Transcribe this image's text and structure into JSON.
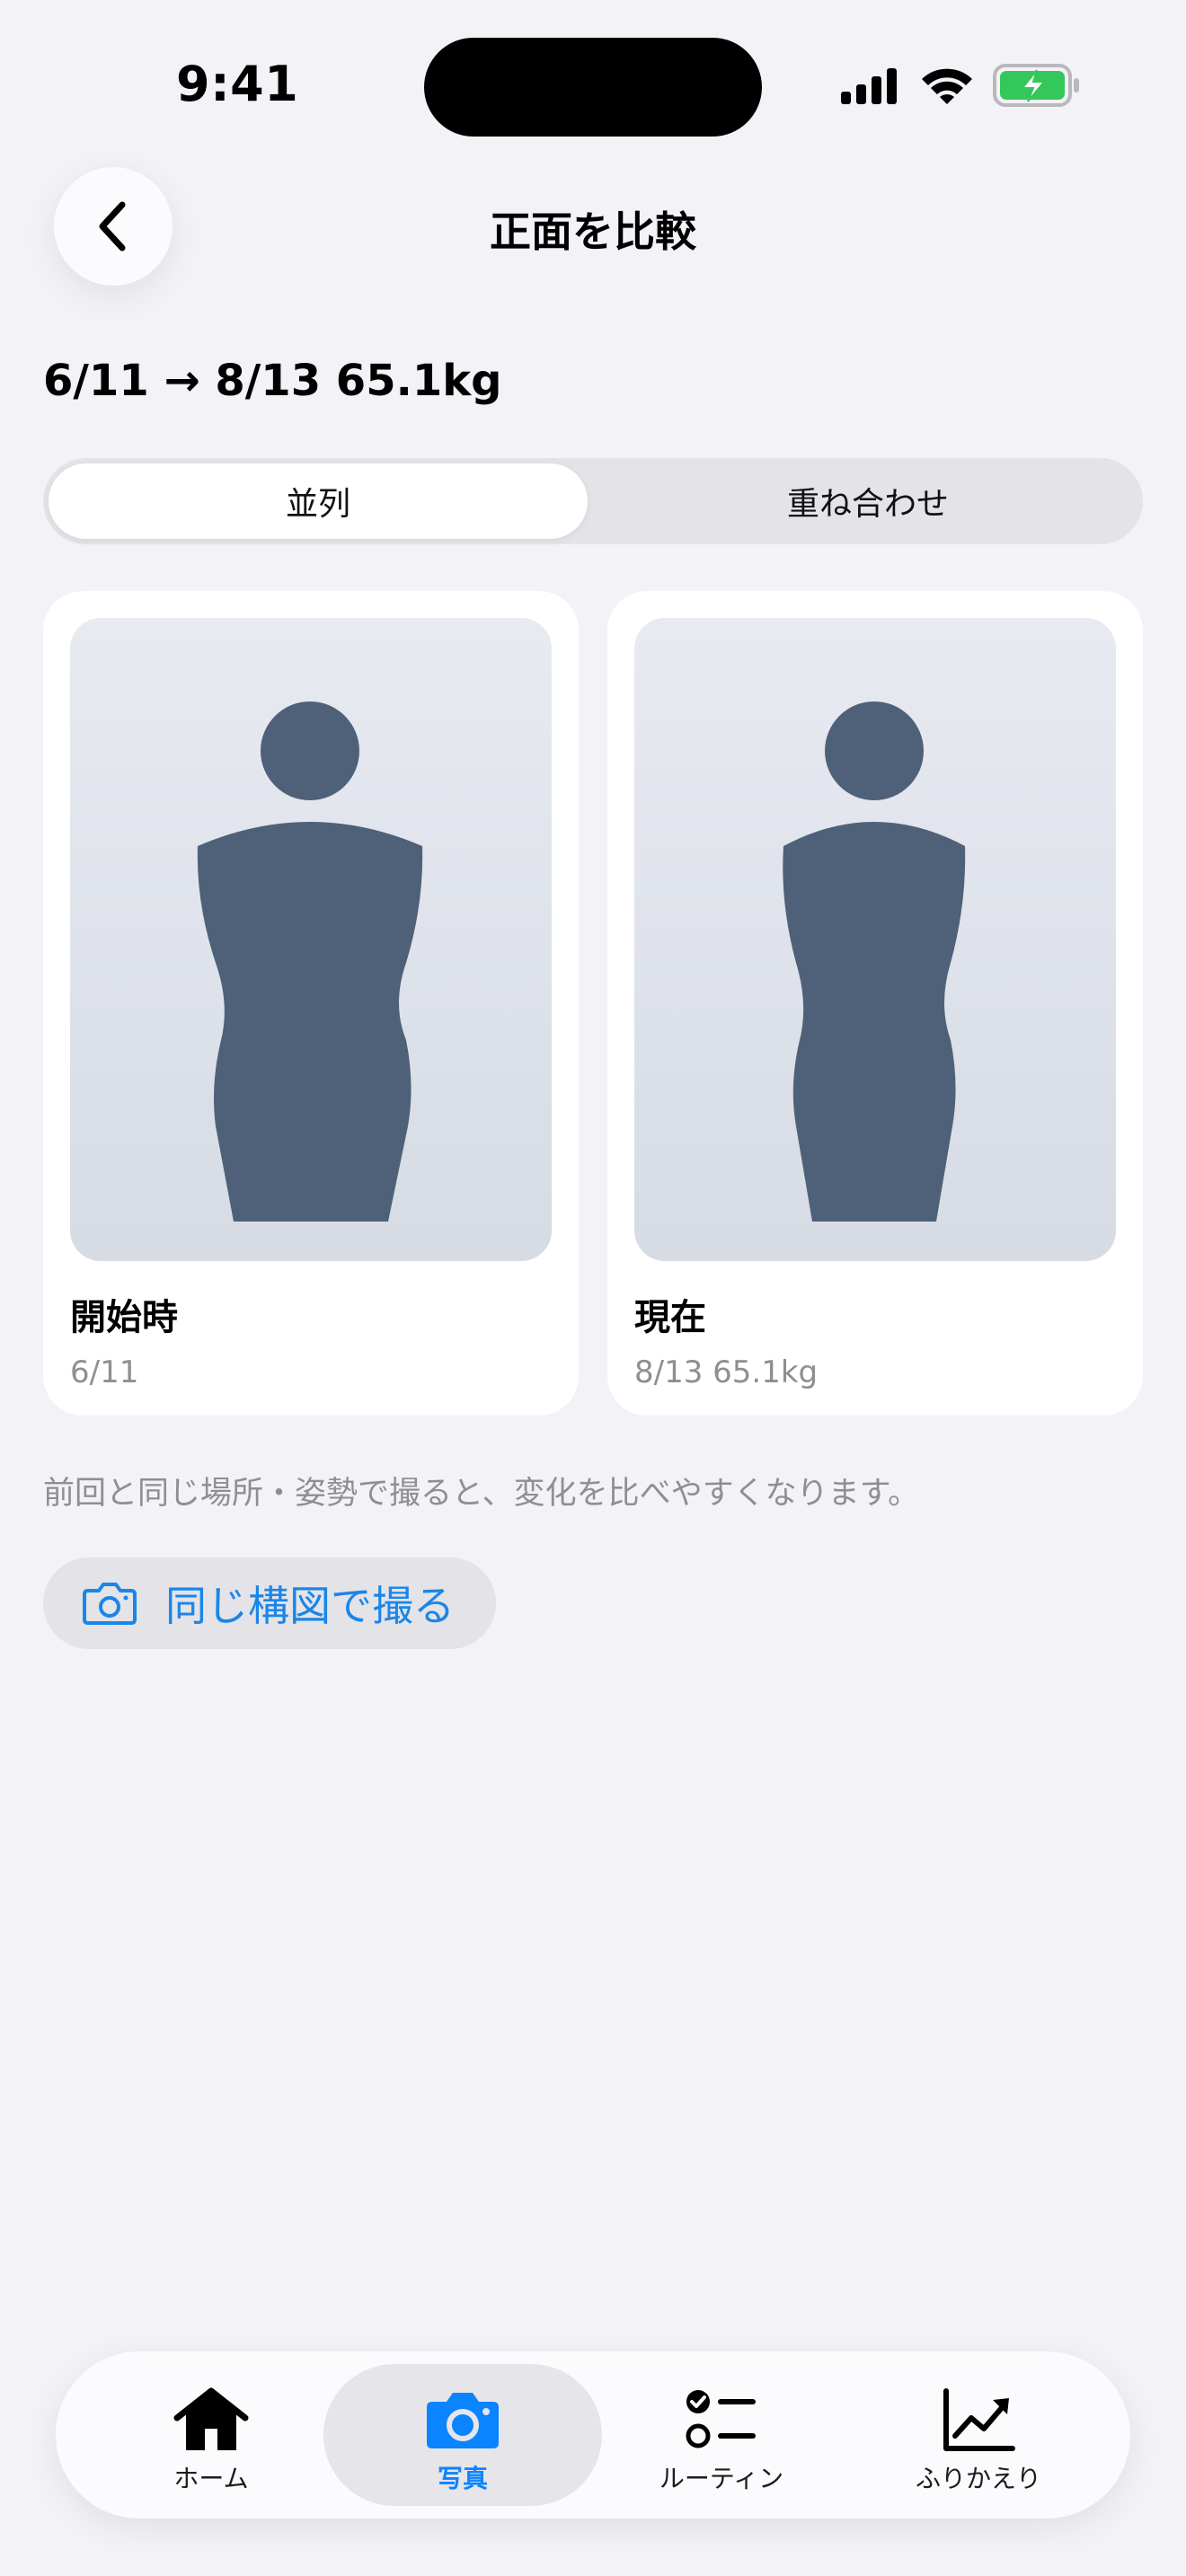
{
  "status_bar": {
    "time": "9:41"
  },
  "nav": {
    "title": "正面を比較"
  },
  "summary": "6/11 → 8/13 65.1kg",
  "segmented": {
    "options": [
      "並列",
      "重ね合わせ"
    ],
    "selected": "並列"
  },
  "cards": [
    {
      "label": "開始時",
      "sub": "6/11"
    },
    {
      "label": "現在",
      "sub": "8/13 65.1kg"
    }
  ],
  "hint": "前回と同じ場所・姿勢で撮ると、変化を比べやすくなります。",
  "retake": {
    "label": "同じ構図で撮る",
    "icon": "camera-icon"
  },
  "tabbar": {
    "items": [
      {
        "label": "ホーム",
        "icon": "house-icon"
      },
      {
        "label": "写真",
        "icon": "camera-icon"
      },
      {
        "label": "ルーティン",
        "icon": "checklist-icon"
      },
      {
        "label": "ふりかえり",
        "icon": "chart-up-icon"
      }
    ],
    "selected": "写真"
  },
  "colors": {
    "accent": "#0a84ff",
    "silhouette": "#4f6178",
    "battery": "#34c759",
    "background": "#f2f2f7"
  }
}
